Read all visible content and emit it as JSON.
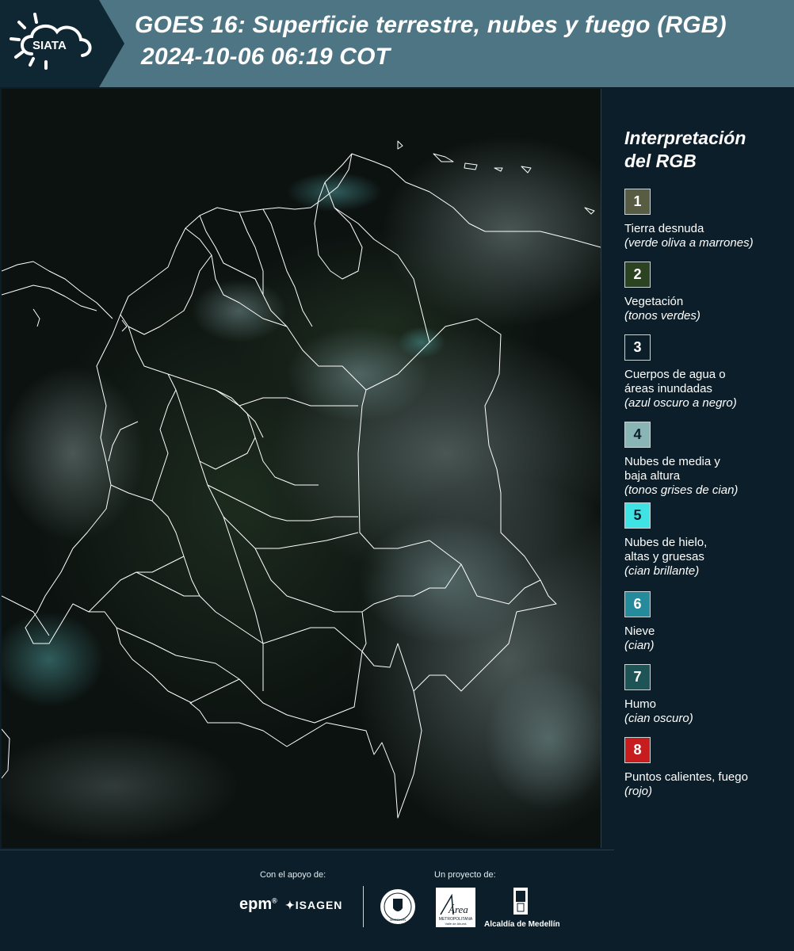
{
  "header": {
    "logo_text": "SIATA",
    "title_line1": "GOES 16: Superficie terrestre, nubes y fuego (RGB)",
    "title_line2": "2024-10-06 06:19 COT"
  },
  "legend": {
    "title": "Interpretación\ndel RGB",
    "items": [
      {
        "num": "1",
        "label": "Tierra desnuda",
        "sub": "(verde oliva a marrones)",
        "color": "#575c42"
      },
      {
        "num": "2",
        "label": "Vegetación",
        "sub": "(tonos verdes)",
        "color": "#2b4321"
      },
      {
        "num": "3",
        "label": "Cuerpos de agua o\náreas inundadas",
        "sub": "(azul oscuro a negro)",
        "color": "#0b1e2a"
      },
      {
        "num": "4",
        "label": "Nubes de media y\nbaja altura",
        "sub": "(tonos grises de cian)",
        "color": "#89b5b5"
      },
      {
        "num": "5",
        "label": "Nubes de hielo,\naltas y gruesas",
        "sub": "(cian brillante)",
        "color": "#3fe3e4"
      },
      {
        "num": "6",
        "label": "Nieve",
        "sub": "(cian)",
        "color": "#258b9c"
      },
      {
        "num": "7",
        "label": "Humo",
        "sub": "(cian oscuro)",
        "color": "#1f5457"
      },
      {
        "num": "8",
        "label": "Puntos calientes, fuego",
        "sub": "(rojo)",
        "color": "#c81d1f"
      }
    ]
  },
  "footer": {
    "support_caption": "Con el apoyo de:",
    "project_caption": "Un proyecto de:",
    "epm": "epm",
    "isagen": "ISAGEN",
    "area_text": "Área",
    "area_sub": "METROPOLITANA",
    "area_sub2": "Valle de Aburrá",
    "seal_text": "MEDELLÍN",
    "alcaldia": "Alcaldía de Medellín"
  },
  "colors": {
    "header_bg": "#4e7583",
    "panel_bg": "#0b1e2a",
    "boundary_line": "#ffffff"
  }
}
